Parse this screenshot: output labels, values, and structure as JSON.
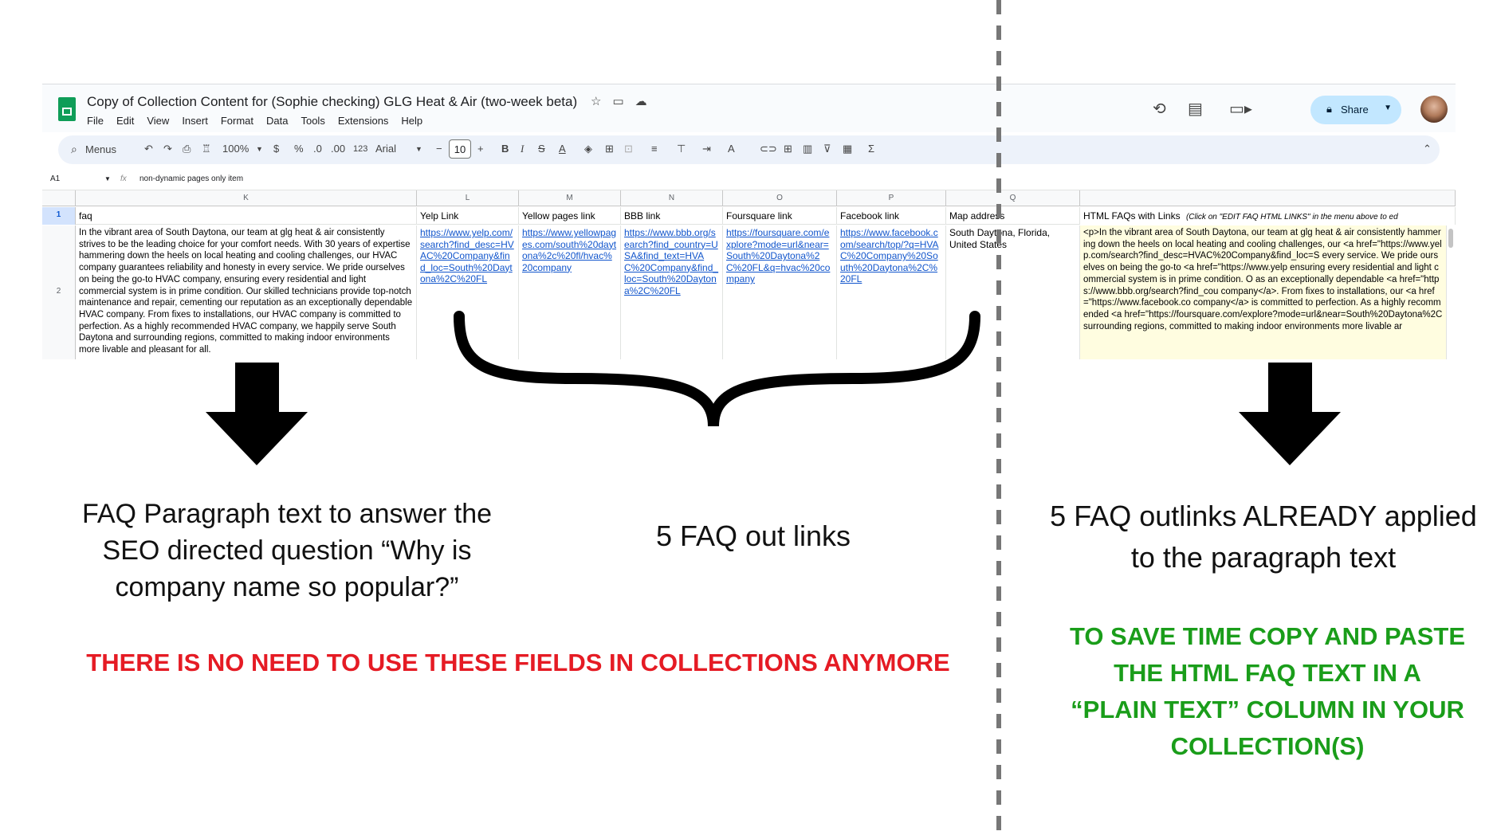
{
  "app": {
    "doc_title": "Copy of Collection Content for (Sophie checking) GLG Heat & Air (two-week beta)",
    "menu": [
      "File",
      "Edit",
      "View",
      "Insert",
      "Format",
      "Data",
      "Tools",
      "Extensions",
      "Help"
    ],
    "share_label": "Share"
  },
  "toolbar": {
    "menus_label": "Menus",
    "zoom": "100%",
    "currency": "$",
    "percent": "%",
    "dec_decrease": ".0",
    "dec_increase": ".00",
    "number_format": "123",
    "font": "Arial",
    "font_size": "10"
  },
  "formula_bar": {
    "cell_ref": "A1",
    "fx": "fx",
    "value": "non-dynamic pages only item"
  },
  "columns": [
    "K",
    "L",
    "M",
    "N",
    "O",
    "P",
    "Q"
  ],
  "rows": {
    "row1_num": "1",
    "row2_num": "2"
  },
  "headers": {
    "K": "faq",
    "L": "Yelp Link",
    "M": "Yellow pages link",
    "N": "BBB link",
    "O": "Foursquare link",
    "P": "Facebook link",
    "Q": "Map address",
    "R": "HTML FAQs with Links",
    "R_note": "(Click on \"EDIT FAQ HTML LINKS\" in the menu above to ed"
  },
  "row2": {
    "K": "In the vibrant area of South Daytona, our team at glg heat & air consistently strives to be the leading choice for your comfort needs. With 30 years of expertise hammering down the heels on local heating and cooling challenges, our HVAC company guarantees reliability and honesty in every service. We pride ourselves on being the go-to HVAC company, ensuring every residential and light commercial system is in prime condition. Our skilled technicians provide top-notch maintenance and repair, cementing our reputation as an exceptionally dependable HVAC company. From fixes to installations, our HVAC company is committed to perfection. As a highly recommended HVAC company, we happily serve South Daytona and surrounding regions, committed to making indoor environments more livable and pleasant for all.",
    "L": "https://www.yelp.com/search?find_desc=HVAC%20Company&find_loc=South%20Daytona%2C%20FL",
    "M": "https://www.yellowpages.com/south%20daytona%2c%20fl/hvac%20company",
    "N": "https://www.bbb.org/search?find_country=USA&find_text=HVAC%20Company&find_loc=South%20Daytona%2C%20FL",
    "O": "https://foursquare.com/explore?mode=url&near=South%20Daytona%2C%20FL&q=hvac%20company",
    "P": "https://www.facebook.com/search/top/?q=HVAC%20Company%20South%20Daytona%2C%20FL",
    "Q": "South Daytona, Florida, United States",
    "R": "<p>In the vibrant area of South Daytona, our team at glg heat & air consistently hammering down the heels on local heating and cooling challenges, our <a href=\"https://www.yelp.com/search?find_desc=HVAC%20Company&find_loc=S every service. We pride ourselves on being the go-to <a href=\"https://www.yelp ensuring every residential and light commercial system is in prime condition. O as an exceptionally dependable <a href=\"https://www.bbb.org/search?find_cou company</a>. From fixes to installations, our <a href=\"https://www.facebook.co company</a> is committed to perfection. As a highly recommended <a href=\"https://foursquare.com/explore?mode=url&near=South%20Daytona%2C surrounding regions, committed to making indoor environments more livable ar"
  },
  "annotations": {
    "left_caption": "FAQ Paragraph text to answer the SEO directed question “Why is company name so popular?”",
    "middle_caption": "5 FAQ out links",
    "right_caption": "5 FAQ  outlinks ALREADY applied to  the paragraph text",
    "red_notice": "THERE IS NO NEED TO USE THESE FIELDS IN COLLECTIONS ANYMORE",
    "green_notice": "TO SAVE TIME COPY AND PASTE THE HTML FAQ TEXT IN A “PLAIN TEXT” COLUMN IN YOUR COLLECTION(S)",
    "colors": {
      "red": "#e51b24",
      "green": "#1a9d1a",
      "black": "#000000"
    }
  }
}
